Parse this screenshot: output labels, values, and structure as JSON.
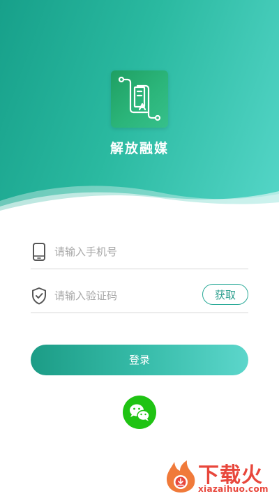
{
  "app": {
    "name": "解放融媒"
  },
  "colors": {
    "accent": "#20a58f",
    "accent_light": "#5cd6cb",
    "wechat": "#1fc313",
    "watermark": "#e8473c"
  },
  "form": {
    "phone": {
      "icon": "phone-icon",
      "placeholder": "请输入手机号",
      "value": ""
    },
    "code": {
      "icon": "shield-check-icon",
      "placeholder": "请输入验证码",
      "value": "",
      "get_code_label": "获取"
    },
    "login_label": "登录"
  },
  "social": {
    "wechat_icon": "wechat-icon"
  },
  "watermark": {
    "title": "下载火",
    "url": "xiazaihuo.com"
  }
}
